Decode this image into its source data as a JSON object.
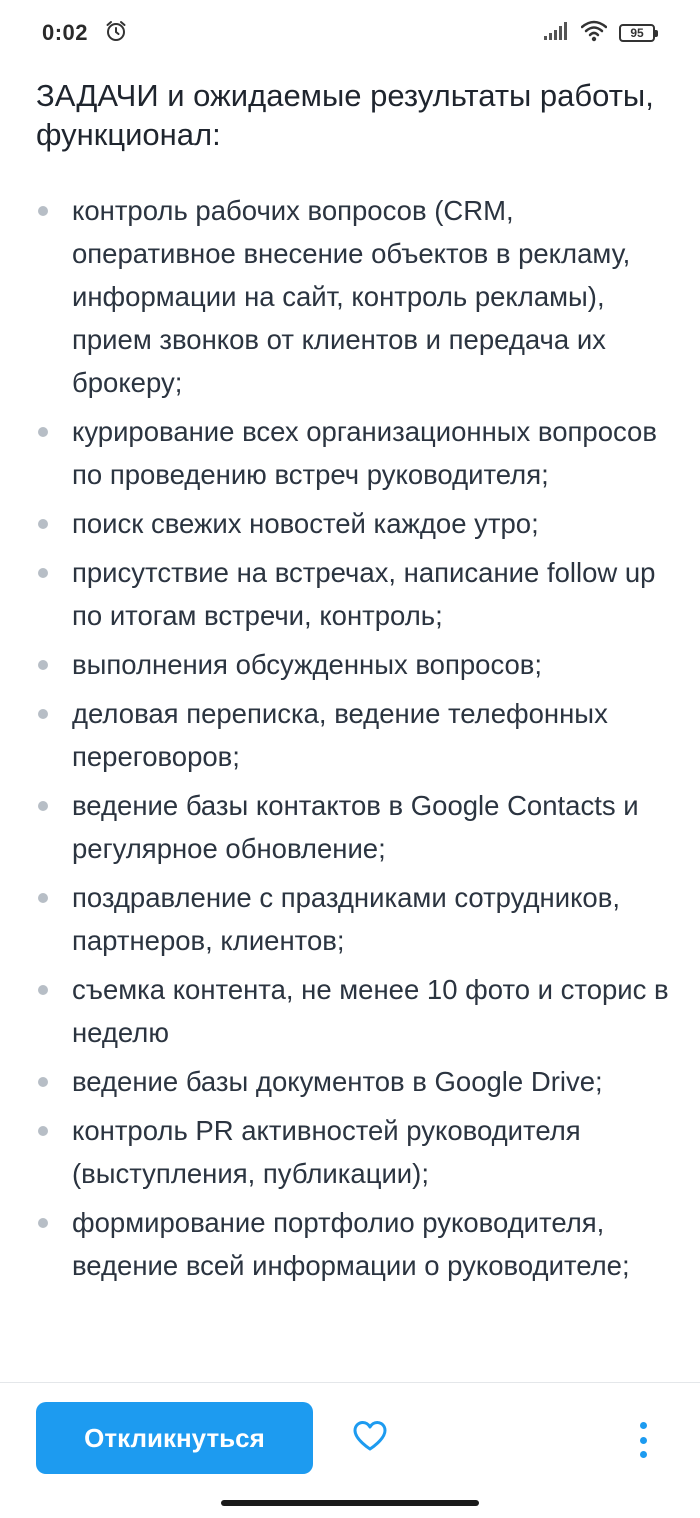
{
  "status_bar": {
    "time": "0:02",
    "battery_level": "95",
    "icons": [
      "alarm-icon",
      "signal-icon",
      "wifi-icon",
      "battery-icon"
    ]
  },
  "section": {
    "title": "ЗАДАЧИ и ожидаемые результаты работы, функционал:",
    "items": [
      "контроль рабочих вопросов (CRM, оперативное внесение объектов в рекламу, информации на сайт, контроль рекламы), прием звонков от клиентов и передача их брокеру;",
      "курирование всех организационных вопросов по проведению встреч руководителя;",
      "поиск свежих новостей каждое утро;",
      "присутствие на встречах, написание follow up по итогам встречи, контроль;",
      "выполнения обсужденных вопросов;",
      "деловая переписка, ведение телефонных переговоров;",
      "ведение базы контактов в Google Contacts и регулярное обновление;",
      "поздравление с праздниками сотрудников, партнеров, клиентов;",
      "съемка контента, не менее 10 фото и сторис в неделю",
      "ведение базы документов в Google Drive;",
      "контроль PR активностей руководителя (выступления, публикации);",
      "формирование портфолио руководителя, ведение всей информации о руководителе;"
    ]
  },
  "actions": {
    "respond_label": "Откликнуться",
    "favorite_icon": "heart-icon",
    "more_icon": "more-vertical-icon",
    "accent_color": "#1d9bf0"
  }
}
